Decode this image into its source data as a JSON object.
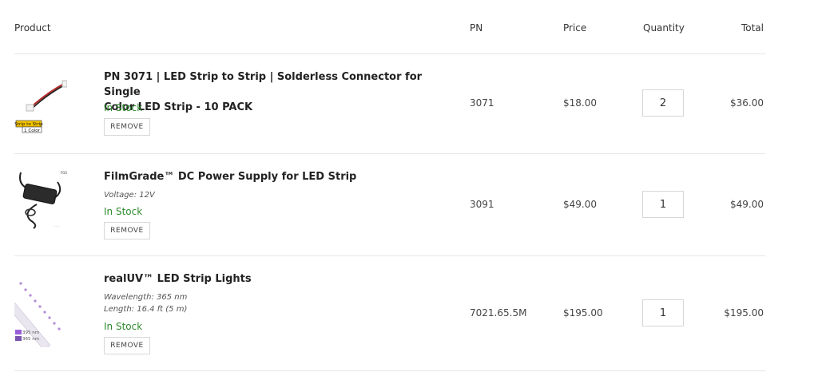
{
  "header": {
    "product": "Product",
    "pn": "PN",
    "price": "Price",
    "quantity": "Quantity",
    "total": "Total"
  },
  "items": [
    {
      "title_line1": "PN 3071 | LED Strip to Strip | Solderless Connector for Single",
      "title_line2": "Color LED Strip - 10 PACK",
      "attributes": [],
      "stock": "In Stock",
      "remove": "REMOVE",
      "pn": "3071",
      "price": "$18.00",
      "quantity": "2",
      "total": "$36.00",
      "thumb_label_1": "Strip to Strip",
      "thumb_label_2": "1 Color"
    },
    {
      "title_line1": "FilmGrade™ DC Power Supply for LED Strip",
      "title_line2": "",
      "attributes": [
        "Voltage: 12V"
      ],
      "stock": "In Stock",
      "remove": "REMOVE",
      "pn": "3091",
      "price": "$49.00",
      "quantity": "1",
      "total": "$49.00"
    },
    {
      "title_line1": "realUV™ LED Strip Lights",
      "title_line2": "",
      "attributes": [
        "Wavelength: 365 nm",
        "Length: 16.4 ft (5 m)"
      ],
      "stock": "In Stock",
      "remove": "REMOVE",
      "pn": "7021.65.5M",
      "price": "$195.00",
      "quantity": "1",
      "total": "$195.00",
      "thumb_label_1": "395 nm",
      "thumb_label_2": "365 nm"
    }
  ],
  "colors": {
    "in_stock": "#2e8b2e",
    "divider": "#e6e6e6"
  }
}
